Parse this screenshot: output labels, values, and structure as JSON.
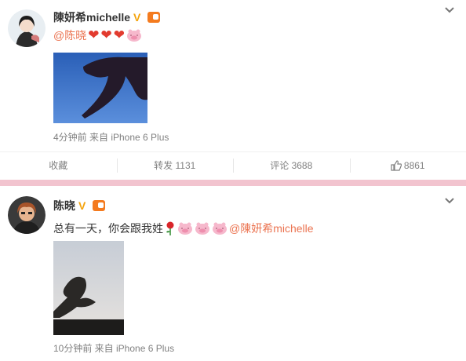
{
  "posts": [
    {
      "username": "陳妍希michelle",
      "content": {
        "mention": "@陈晓",
        "heart_glyph": "❤"
      },
      "meta": "4分钟前 来自 iPhone 6 Plus",
      "actions": {
        "favorite": "收藏",
        "repost": "转发 1131",
        "comment": "评论 3688",
        "like": "8861"
      }
    },
    {
      "username": "陈晓",
      "content": {
        "text": "总有一天，你会跟我姓",
        "mention": "@陳妍希michelle"
      },
      "meta": "10分钟前 来自 iPhone 6 Plus"
    }
  ],
  "icons": [
    "avatar",
    "verified-v-icon",
    "member-icon",
    "chevron-down-icon",
    "heart-emoji-icon",
    "pig-emoji-icon",
    "rose-emoji-icon",
    "thumbs-up-icon"
  ],
  "colors": {
    "accent_orange": "#eb7350",
    "divider_pink": "#f2c4cf",
    "verified_gold": "#f4a30c",
    "meta_gray": "#808080"
  }
}
